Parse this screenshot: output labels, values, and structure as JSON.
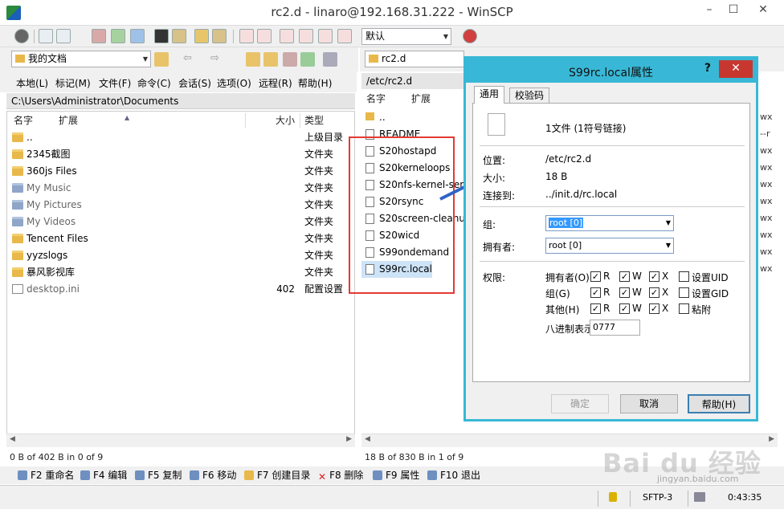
{
  "window": {
    "title": "rc2.d - linaro@192.168.31.222 - WinSCP",
    "minimize": "–",
    "maximize": "☐",
    "close": "✕"
  },
  "toolbar": {
    "session_combo": "默认"
  },
  "left_panel": {
    "location": "我的文档",
    "menu": [
      "本地(L)",
      "标记(M)",
      "文件(F)",
      "命令(C)",
      "会话(S)",
      "选项(O)",
      "远程(R)",
      "帮助(H)"
    ],
    "path": "C:\\Users\\Administrator\\Documents",
    "columns": {
      "name": "名字",
      "ext": "扩展",
      "size": "大小",
      "type": "类型"
    },
    "rows": [
      {
        "name": "..",
        "size": "",
        "type": "上级目录",
        "icon": "up-folder"
      },
      {
        "name": "2345截图",
        "size": "",
        "type": "文件夹",
        "icon": "folder"
      },
      {
        "name": "360js Files",
        "size": "",
        "type": "文件夹",
        "icon": "folder"
      },
      {
        "name": "My Music",
        "size": "",
        "type": "文件夹",
        "icon": "folder-system"
      },
      {
        "name": "My Pictures",
        "size": "",
        "type": "文件夹",
        "icon": "folder-system"
      },
      {
        "name": "My Videos",
        "size": "",
        "type": "文件夹",
        "icon": "folder-system"
      },
      {
        "name": "Tencent Files",
        "size": "",
        "type": "文件夹",
        "icon": "folder"
      },
      {
        "name": "yyzslogs",
        "size": "",
        "type": "文件夹",
        "icon": "folder"
      },
      {
        "name": "暴风影视库",
        "size": "",
        "type": "文件夹",
        "icon": "folder"
      },
      {
        "name": "desktop.ini",
        "size": "402",
        "type": "配置设置",
        "icon": "file"
      }
    ],
    "status": "0 B of 402 B in 0 of 9"
  },
  "right_panel": {
    "location": "rc2.d",
    "path": "/etc/rc2.d",
    "columns": {
      "name": "名字",
      "ext": "扩展"
    },
    "rows": [
      {
        "name": ".."
      },
      {
        "name": "README"
      },
      {
        "name": "S20hostapd"
      },
      {
        "name": "S20kerneloops"
      },
      {
        "name": "S20nfs-kernel-ser"
      },
      {
        "name": "S20rsync"
      },
      {
        "name": "S20screen-cleanup"
      },
      {
        "name": "S20wicd"
      },
      {
        "name": "S99ondemand"
      },
      {
        "name": "S99rc.local"
      }
    ],
    "status": "18 B of 830 B in 1 of 9",
    "cut_perms": [
      "wx",
      "--r",
      "wx",
      "wx",
      "wx",
      "wx",
      "wx",
      "wx",
      "wx",
      "wx"
    ]
  },
  "fkeys": [
    {
      "label": "F2 重命名"
    },
    {
      "label": "F4 编辑"
    },
    {
      "label": "F5 复制"
    },
    {
      "label": "F6 移动"
    },
    {
      "label": "F7 创建目录"
    },
    {
      "label": "F8 删除"
    },
    {
      "label": "F9 属性"
    },
    {
      "label": "F10 退出"
    }
  ],
  "bottom": {
    "protocol": "SFTP-3",
    "time": "0:43:35"
  },
  "dialog": {
    "title": "S99rc.local属性",
    "help_glyph": "?",
    "tabs": [
      "通用",
      "校验码"
    ],
    "summary": "1文件 (1符号链接)",
    "location_label": "位置:",
    "location": "/etc/rc2.d",
    "size_label": "大小:",
    "size": "18 B",
    "link_label": "连接到:",
    "link": "../init.d/rc.local",
    "group_label": "组:",
    "group": "root [0]",
    "owner_label": "拥有者:",
    "owner": "root [0]",
    "perm_label": "权限:",
    "perm_rows": [
      {
        "label": "拥有者(O)",
        "r": "R",
        "w": "W",
        "x": "X",
        "extra": "设置UID"
      },
      {
        "label": "组(G)",
        "r": "R",
        "w": "W",
        "x": "X",
        "extra": "设置GID"
      },
      {
        "label": "其他(H)",
        "r": "R",
        "w": "W",
        "x": "X",
        "extra": "粘附"
      }
    ],
    "octal_label": "八进制表示",
    "octal": "0777",
    "ok": "确定",
    "cancel": "取消",
    "help": "帮助(H)"
  },
  "watermark": {
    "brand": "Bai du 经验",
    "url": "jingyan.baidu.com"
  },
  "colors": {
    "dialog_border": "#38b8d6",
    "highlight_box": "#e53935",
    "arrow": "#2f64c8",
    "close_button": "#c7372f"
  }
}
